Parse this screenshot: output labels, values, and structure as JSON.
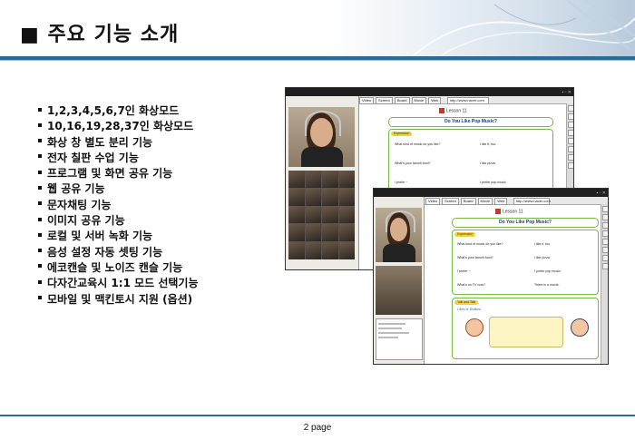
{
  "header": {
    "title": "■ 주요 기능 소개"
  },
  "features": [
    "1,2,3,4,5,6,7인 화상모드",
    "10,16,19,28,37인 화상모드",
    "화상 창 별도 분리 기능",
    "전자 칠판 수업 기능",
    "프로그램 및 화면 공유 기능",
    "웹 공유 기능",
    "문자채팅 기능",
    "이미지 공유 기능",
    "로컬 및 서버 녹화 기능",
    "음성 설정 자동 셋팅 기능",
    "에코캔슬 및 노이즈 캔슬 기능",
    "다자간교육시 1:1 모드 선택기능",
    "모바일 및 맥킨토시 지원 (옵션)"
  ],
  "footer": {
    "page": "2 page"
  },
  "screenshots": {
    "toolbar": [
      "Video",
      "Screen",
      "Board",
      "Movie",
      "Web"
    ],
    "url": "http://www.naver.com",
    "lesson": "Lesson 11",
    "question": "Do You Like Pop Music?",
    "expression_tag": "Expression",
    "rows": [
      {
        "q": "What kind of music do you like?",
        "a": "I like it, too."
      },
      {
        "q": "What's your favorit food?",
        "a": "I like pizza."
      },
      {
        "q": "I prefer ~",
        "a": "I prefer pop music."
      },
      {
        "q": "What's on TV now?",
        "a": "There is a movie."
      }
    ],
    "talk_tag": "Talk and Talk",
    "likes_label": "Likes or Dislikes",
    "chat_tabs": [
      "Chat",
      "User (10)",
      "Image"
    ]
  },
  "colors": {
    "accent": "#2a6d9a",
    "green_frame": "#7ab648",
    "korean_red": "#d23a1f"
  }
}
